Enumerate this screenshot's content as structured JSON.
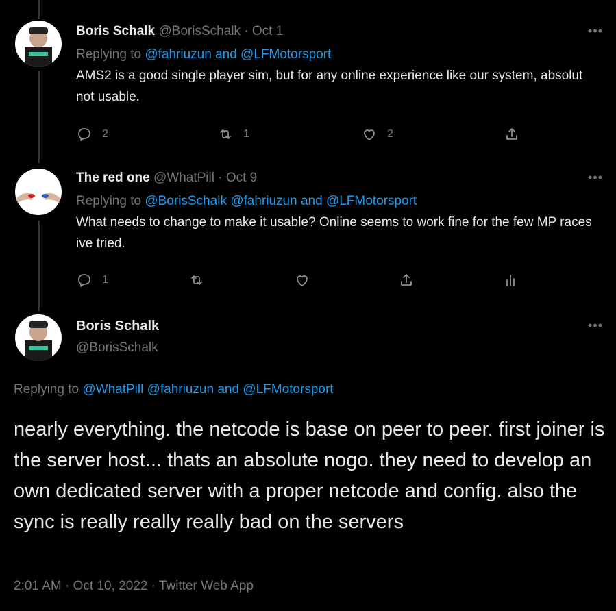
{
  "colors": {
    "background": "#000000",
    "text": "#e7e9ea",
    "muted": "#71767b",
    "link": "#1d9bf0"
  },
  "tweets": [
    {
      "name": "Boris Schalk",
      "handle": "@BorisSchalk",
      "separator": "·",
      "date": "Oct 1",
      "replying_prefix": "Replying to",
      "replying_to": "@fahriuzun and @LFMotorsport",
      "text": "AMS2 is a good single player sim, but for any online experience like our system, absolut not usable.",
      "more_icon": "more-icon",
      "actions": [
        {
          "icon": "reply-icon",
          "count": "2"
        },
        {
          "icon": "retweet-icon",
          "count": "1"
        },
        {
          "icon": "like-icon",
          "count": "2"
        },
        {
          "icon": "share-icon",
          "count": ""
        }
      ]
    },
    {
      "name": "The red one",
      "handle": "@WhatPill",
      "separator": "·",
      "date": "Oct 9",
      "replying_prefix": "Replying to",
      "replying_to": "@BorisSchalk @fahriuzun and @LFMotorsport",
      "text": "What needs to change to make it usable? Online seems to work fine for the few MP races ive tried.",
      "more_icon": "more-icon",
      "actions": [
        {
          "icon": "reply-icon",
          "count": "1"
        },
        {
          "icon": "retweet-icon",
          "count": ""
        },
        {
          "icon": "like-icon",
          "count": ""
        },
        {
          "icon": "share-icon",
          "count": ""
        },
        {
          "icon": "analytics-icon",
          "count": ""
        }
      ]
    }
  ],
  "focus": {
    "name": "Boris Schalk",
    "handle": "@BorisSchalk",
    "replying_prefix": "Replying to",
    "replying_to": "@WhatPill @fahriuzun and @LFMotorsport",
    "text": "nearly everything. the netcode is base on peer to peer. first joiner is the server host... thats an absolute nogo. they need to develop an own dedicated server with a proper netcode and config. also the sync is really really really bad on the servers",
    "meta": "2:01 AM · Oct 10, 2022 · Twitter Web App"
  }
}
